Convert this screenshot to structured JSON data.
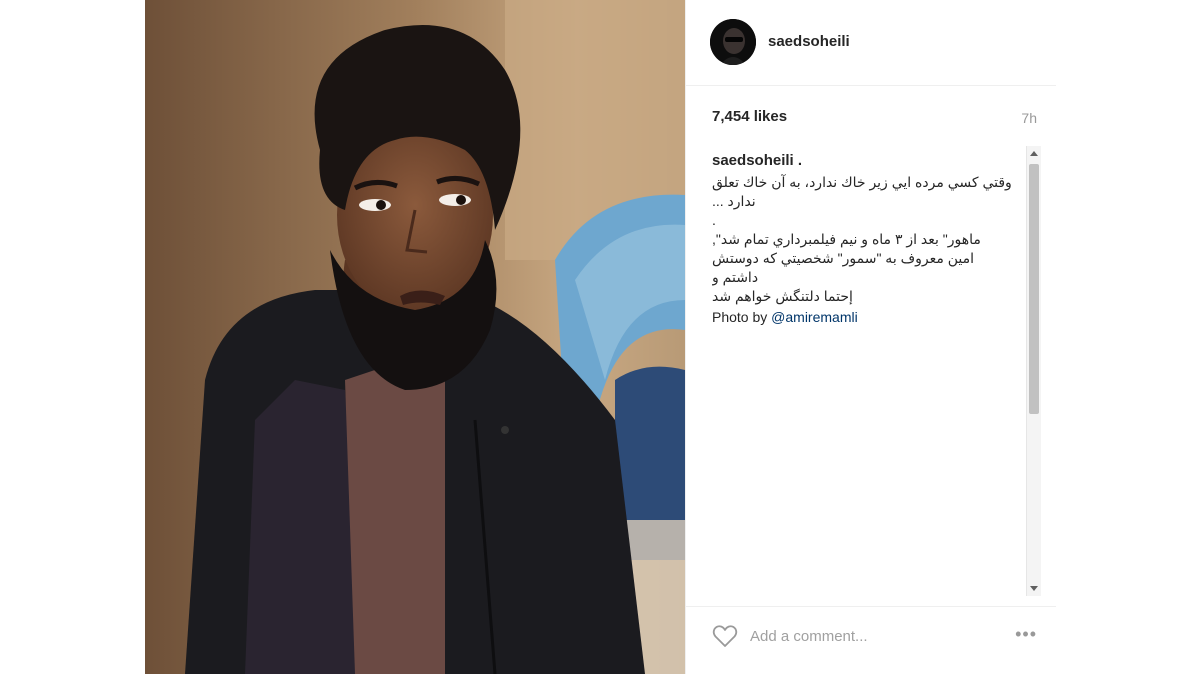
{
  "post": {
    "username": "saedsoheili",
    "likes": "7,454 likes",
    "time_ago": "7h",
    "caption": {
      "username": "saedsoheili .",
      "lines": [
        "وقتي کسي مرده ايي زير خاك ندارد، به آن خاك تعلق ندارد ...",
        ".",
        "ماهور\" بعد از ۳ ماه و نيم فيلمبرداري تمام شد\",",
        "امين معروف به \"سمور\" شخصيتي که دوستش داشتم و",
        "إحتما دلتنگش خواهم شد"
      ],
      "photo_by_prefix": "Photo by ",
      "photo_by_handle": "@amiremamli"
    },
    "add_comment_placeholder": "Add a comment...",
    "more_label": "•••"
  },
  "icons": {
    "like": "heart-outline-icon",
    "more": "more-options-icon",
    "scroll_up": "scroll-up-arrow-icon",
    "scroll_down": "scroll-down-arrow-icon"
  },
  "colors": {
    "text": "#262626",
    "muted": "#999999",
    "link": "#003569",
    "border": "#efefef"
  }
}
